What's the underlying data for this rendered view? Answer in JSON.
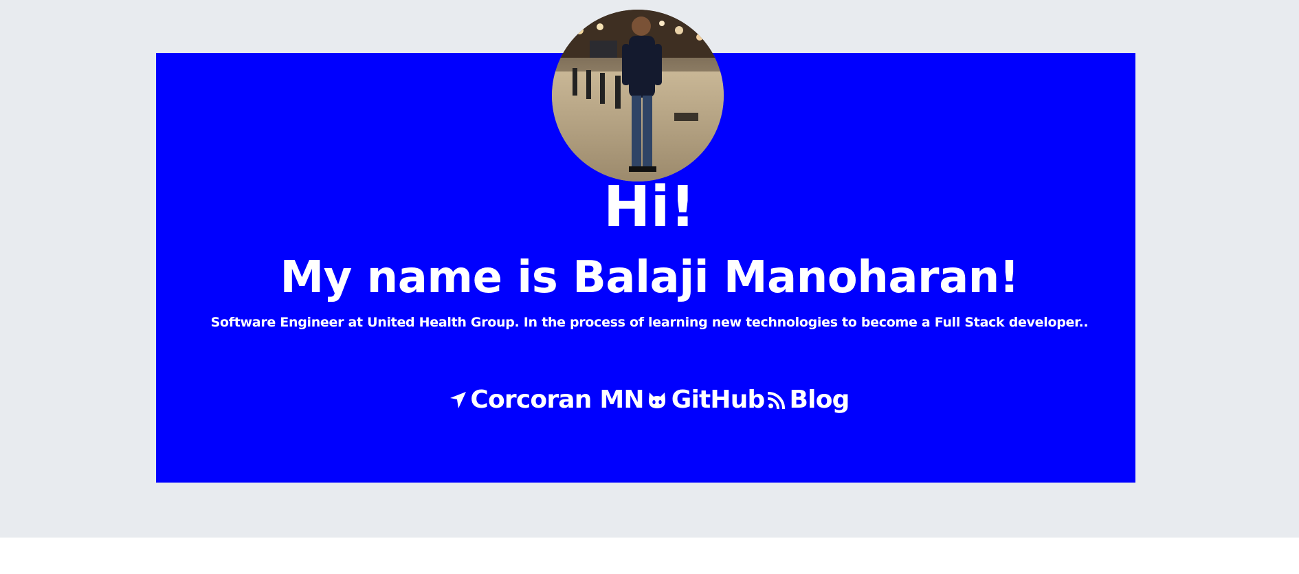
{
  "hero": {
    "greeting": "Hi!",
    "name": "My name is Balaji Manoharan!",
    "tagline": "Software Engineer at United Health Group. In the process of learning new technologies to become a Full Stack developer.."
  },
  "links": [
    {
      "icon": "location-arrow-icon",
      "label": "Corcoran MN"
    },
    {
      "icon": "github-icon",
      "label": "GitHub"
    },
    {
      "icon": "rss-icon",
      "label": "Blog"
    }
  ],
  "colors": {
    "page_background": "#e8ebef",
    "hero_background": "#0000fe",
    "text": "#ffffff"
  }
}
